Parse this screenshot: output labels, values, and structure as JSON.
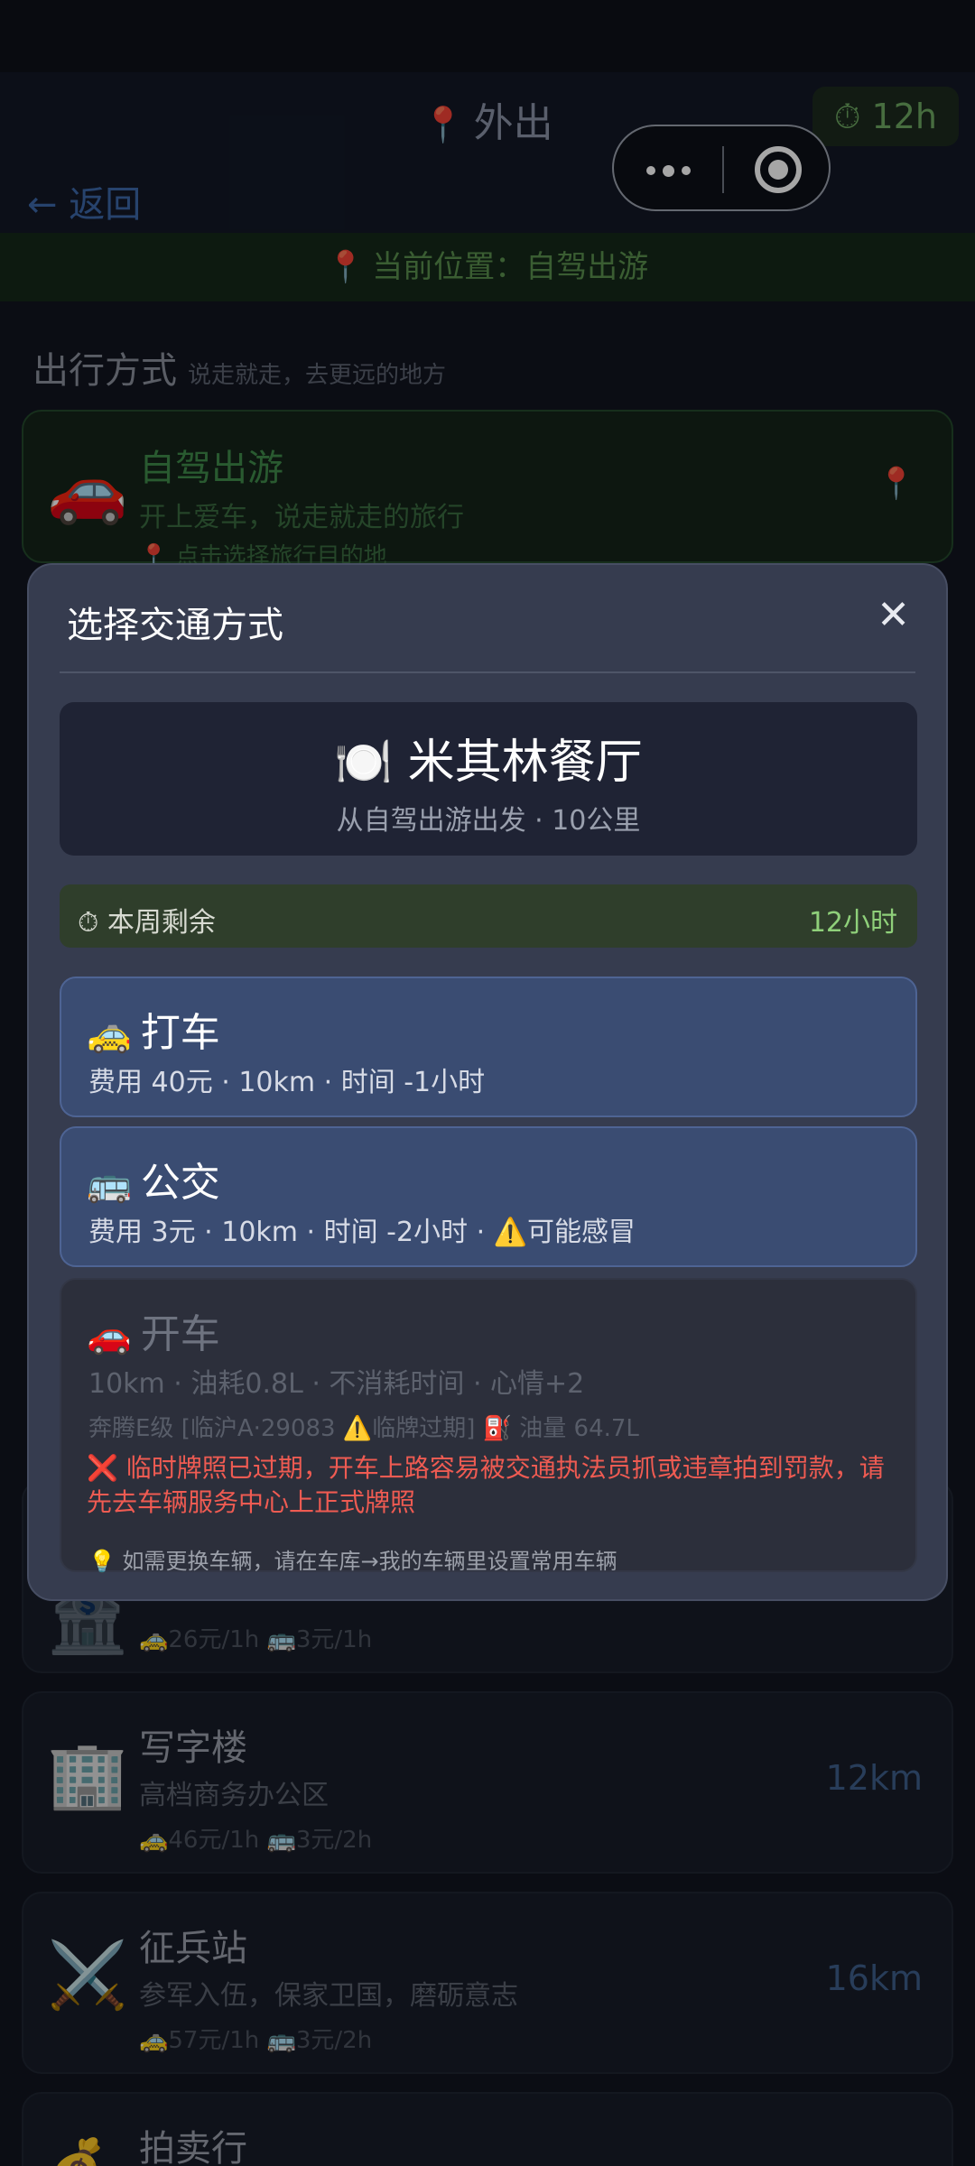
{
  "header": {
    "title": "外出",
    "title_icon": "pin-icon",
    "time_badge": "⏱ 12h",
    "back": "← 返回"
  },
  "capsule": {
    "more_icon": "more-dots-icon",
    "close_icon": "target-icon"
  },
  "location": {
    "text": "当前位置：自驾出游"
  },
  "section": {
    "title": "出行方式",
    "subtitle": "说走就走，去更远的地方"
  },
  "cards": [
    {
      "icon": "🚗",
      "title": "自驾出游",
      "subtitle": "开上爱车，说走就走的旅行",
      "price": "📍 点击选择旅行目的地",
      "right": "📍",
      "active": true
    },
    {
      "icon": "🏦",
      "title": "",
      "subtitle": "",
      "price": "🚕26元/1h  🚌3元/1h",
      "right": ""
    },
    {
      "icon": "🏢",
      "title": "写字楼",
      "subtitle": "高档商务办公区",
      "price": "🚕46元/1h  🚌3元/2h",
      "right": "12km"
    },
    {
      "icon": "⚔️",
      "title": "征兵站",
      "subtitle": "参军入伍，保家卫国，磨砺意志",
      "price": "🚕57元/1h  🚌3元/2h",
      "right": "16km"
    },
    {
      "icon": "💰",
      "title": "拍卖行",
      "subtitle": "",
      "price": "",
      "right": ""
    }
  ],
  "modal": {
    "title": "选择交通方式",
    "close": "✕",
    "destination": {
      "name": "🍽️ 米其林餐厅",
      "sub": "从自驾出游出发 · 10公里"
    },
    "remaining": {
      "label": "⏱ 本周剩余",
      "value": "12小时"
    },
    "options": [
      {
        "emoji": "🚕",
        "name": "打车",
        "meta": "费用 40元 · 10km · 时间 -1小时",
        "enabled": true
      },
      {
        "emoji": "🚌",
        "name": "公交",
        "meta": "费用 3元 · 10km · 时间 -2小时 · ⚠️可能感冒",
        "enabled": true
      },
      {
        "emoji": "🚗",
        "name": "开车",
        "meta": "10km · 油耗0.8L · 不消耗时间 · 心情+2",
        "vehicle": "奔腾E级 [临沪A·29083 ⚠️临牌过期] ⛽ 油量 64.7L",
        "warning": "❌ 临时牌照已过期，开车上路容易被交通执法员抓或违章拍到罚款，请先去车辆服务中心上正式牌照",
        "tip": "💡 如需更换车辆，请在车库→我的车辆里设置常用车辆",
        "enabled": false
      }
    ]
  }
}
